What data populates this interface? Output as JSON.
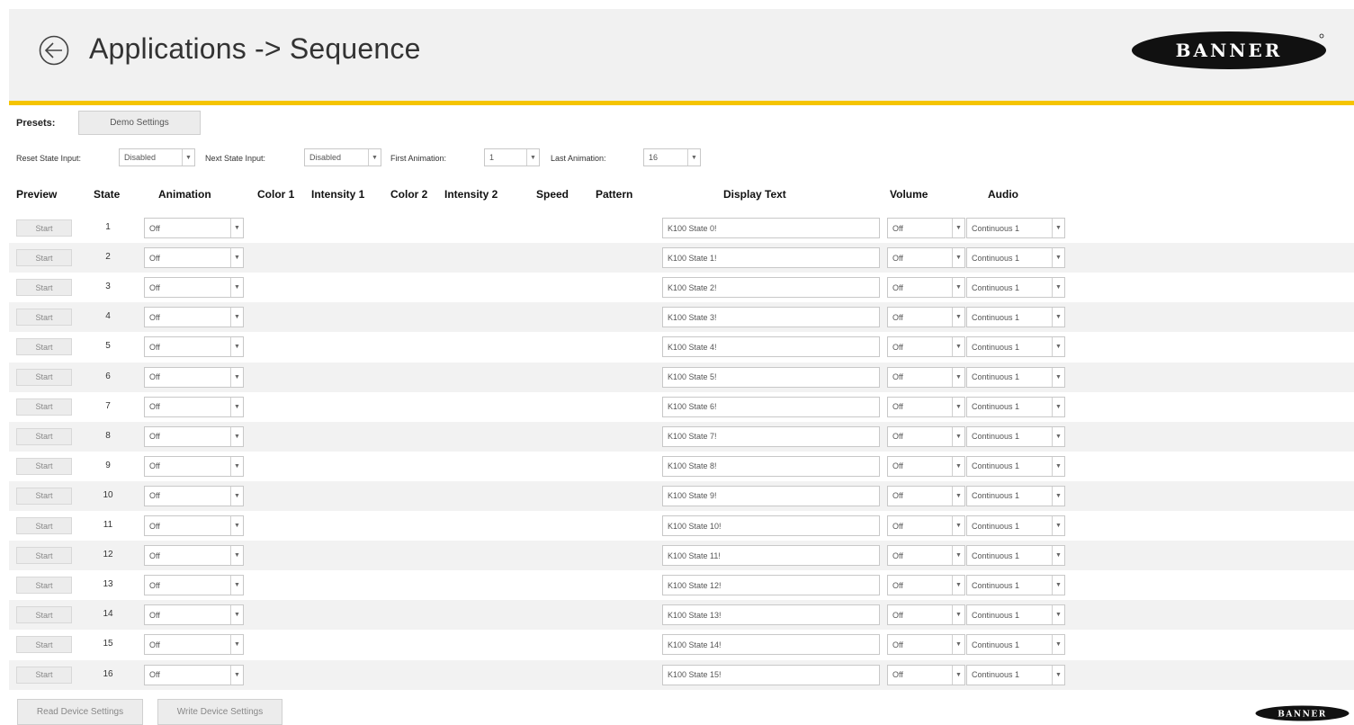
{
  "header": {
    "title": "Applications -> Sequence",
    "brand": "BANNER",
    "accent_color": "#f5c400"
  },
  "presets": {
    "label": "Presets:",
    "button_label": "Demo Settings"
  },
  "config": {
    "reset_label": "Reset State Input:",
    "reset_value": "Disabled",
    "next_label": "Next State Input:",
    "next_value": "Disabled",
    "first_label": "First Animation:",
    "first_value": "1",
    "last_label": "Last Animation:",
    "last_value": "16"
  },
  "columns": {
    "preview": "Preview",
    "state": "State",
    "animation": "Animation",
    "color1": "Color 1",
    "intensity1": "Intensity 1",
    "color2": "Color 2",
    "intensity2": "Intensity 2",
    "speed": "Speed",
    "pattern": "Pattern",
    "display_text": "Display Text",
    "volume": "Volume",
    "audio": "Audio"
  },
  "rows": [
    {
      "start": "Start",
      "state": "1",
      "animation": "Off",
      "text": "K100 State 0!",
      "volume": "Off",
      "audio": "Continuous 1"
    },
    {
      "start": "Start",
      "state": "2",
      "animation": "Off",
      "text": "K100 State 1!",
      "volume": "Off",
      "audio": "Continuous 1"
    },
    {
      "start": "Start",
      "state": "3",
      "animation": "Off",
      "text": "K100 State 2!",
      "volume": "Off",
      "audio": "Continuous 1"
    },
    {
      "start": "Start",
      "state": "4",
      "animation": "Off",
      "text": "K100 State 3!",
      "volume": "Off",
      "audio": "Continuous 1"
    },
    {
      "start": "Start",
      "state": "5",
      "animation": "Off",
      "text": "K100 State 4!",
      "volume": "Off",
      "audio": "Continuous 1"
    },
    {
      "start": "Start",
      "state": "6",
      "animation": "Off",
      "text": "K100 State 5!",
      "volume": "Off",
      "audio": "Continuous 1"
    },
    {
      "start": "Start",
      "state": "7",
      "animation": "Off",
      "text": "K100 State 6!",
      "volume": "Off",
      "audio": "Continuous 1"
    },
    {
      "start": "Start",
      "state": "8",
      "animation": "Off",
      "text": "K100 State 7!",
      "volume": "Off",
      "audio": "Continuous 1"
    },
    {
      "start": "Start",
      "state": "9",
      "animation": "Off",
      "text": "K100 State 8!",
      "volume": "Off",
      "audio": "Continuous 1"
    },
    {
      "start": "Start",
      "state": "10",
      "animation": "Off",
      "text": "K100 State 9!",
      "volume": "Off",
      "audio": "Continuous 1"
    },
    {
      "start": "Start",
      "state": "11",
      "animation": "Off",
      "text": "K100 State 10!",
      "volume": "Off",
      "audio": "Continuous 1"
    },
    {
      "start": "Start",
      "state": "12",
      "animation": "Off",
      "text": "K100 State 11!",
      "volume": "Off",
      "audio": "Continuous 1"
    },
    {
      "start": "Start",
      "state": "13",
      "animation": "Off",
      "text": "K100 State 12!",
      "volume": "Off",
      "audio": "Continuous 1"
    },
    {
      "start": "Start",
      "state": "14",
      "animation": "Off",
      "text": "K100 State 13!",
      "volume": "Off",
      "audio": "Continuous 1"
    },
    {
      "start": "Start",
      "state": "15",
      "animation": "Off",
      "text": "K100 State 14!",
      "volume": "Off",
      "audio": "Continuous 1"
    },
    {
      "start": "Start",
      "state": "16",
      "animation": "Off",
      "text": "K100 State 15!",
      "volume": "Off",
      "audio": "Continuous 1"
    }
  ],
  "footer": {
    "read_label": "Read Device Settings",
    "write_label": "Write Device Settings"
  }
}
